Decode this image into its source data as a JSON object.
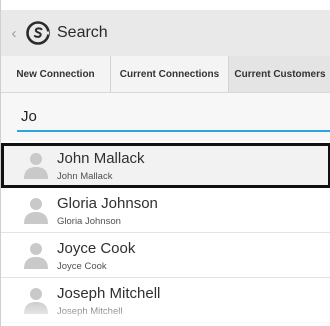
{
  "header": {
    "back_glyph": "‹",
    "title": "Search"
  },
  "tabs": [
    {
      "label": "New Connection"
    },
    {
      "label": "Current Connections"
    },
    {
      "label": "Current Customers"
    }
  ],
  "search": {
    "value": "Jo"
  },
  "results": [
    {
      "name": "John Mallack",
      "subtitle": "John Mallack",
      "selected": true
    },
    {
      "name": "Gloria Johnson",
      "subtitle": "Gloria Johnson",
      "selected": false
    },
    {
      "name": "Joyce Cook",
      "subtitle": "Joyce Cook",
      "selected": false
    },
    {
      "name": "Joseph Mitchell",
      "subtitle": "Joseph Mitchell",
      "selected": false
    }
  ],
  "colors": {
    "accent": "#2aa6e0",
    "header_bg": "#e9e9e9",
    "selection_border": "#111111"
  },
  "icons": {
    "back": "chevron-left-icon",
    "logo": "app-logo-icon",
    "avatar": "person-avatar-icon"
  }
}
